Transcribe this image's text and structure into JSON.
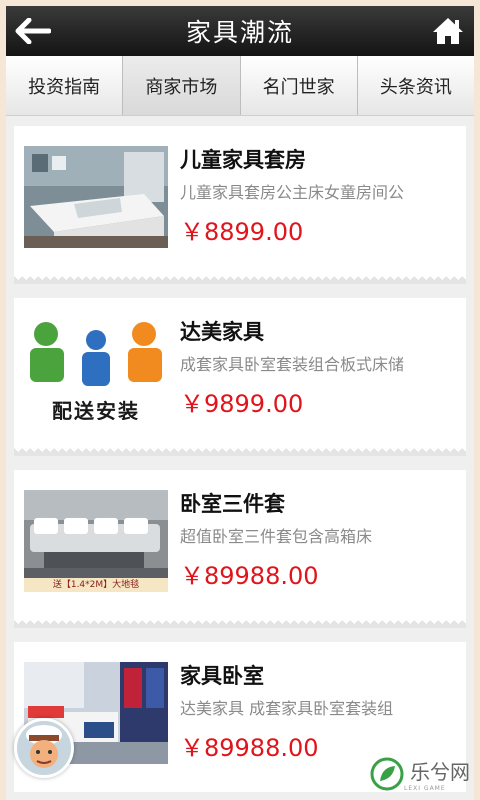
{
  "header": {
    "title": "家具潮流",
    "back_icon": "arrow-left-icon",
    "home_icon": "home-icon"
  },
  "tabs": [
    {
      "label": "投资指南"
    },
    {
      "label": "商家市场",
      "active": true
    },
    {
      "label": "名门世家"
    },
    {
      "label": "头条资讯"
    }
  ],
  "products": [
    {
      "name": "儿童家具套房",
      "desc": "儿童家具套房公主床女童房间公",
      "price": "￥8899.00"
    },
    {
      "name": "达美家具",
      "desc": "成套家具卧室套装组合板式床储",
      "price": "￥9899.00",
      "thumb_caption": "配送安装"
    },
    {
      "name": "卧室三件套",
      "desc": "超值卧室三件套包含高箱床",
      "price": "￥89988.00",
      "thumb_caption": "送【1.4*2M】大地毯"
    },
    {
      "name": "家具卧室",
      "desc": "达美家具  成套家具卧室套装组",
      "price": "￥89988.00"
    }
  ],
  "colors": {
    "header_bg": "#1f1f1f",
    "price": "#e0141a",
    "page_bg": "#efefef"
  },
  "watermark": {
    "logo_text": "乐兮网",
    "logo_sub": "LEXI GAME"
  }
}
